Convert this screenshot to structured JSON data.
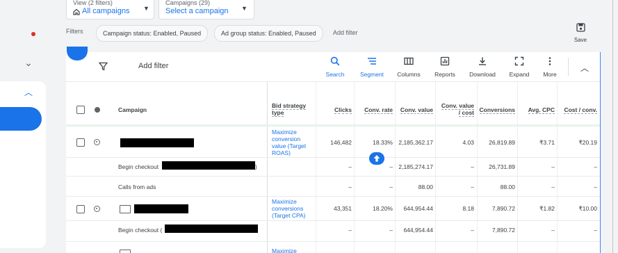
{
  "top": {
    "view": {
      "small": "View (2 filters)",
      "label": "All campaigns"
    },
    "campaigns": {
      "small": "Campaigns (29)",
      "label": "Select a campaign"
    }
  },
  "filters": {
    "label": "Filters",
    "chips": [
      "Campaign status: Enabled, Paused",
      "Ad group status: Enabled, Paused"
    ],
    "add": "Add filter",
    "save": "Save"
  },
  "toolbar": {
    "add_filter": "Add filter",
    "buttons": [
      "Search",
      "Segment",
      "Columns",
      "Reports",
      "Download",
      "Expand",
      "More"
    ]
  },
  "columns": {
    "campaign": "Campaign",
    "bid_strategy_type": [
      "Bid strategy",
      "type"
    ],
    "clicks": "Clicks",
    "conv_rate": "Conv. rate",
    "conv_value": "Conv. value",
    "conv_value_cost": [
      "Conv. value",
      "/ cost"
    ],
    "conversions": "Conversions",
    "avg_cpc": "Avg. CPC",
    "cost_conv": "Cost / conv."
  },
  "rows": [
    {
      "bid": [
        "Maximize",
        "conversion",
        "value (Target",
        "ROAS)"
      ],
      "clicks": "146,482",
      "conv_rate": "18.33%",
      "conv_value": "2,185,362.17",
      "conv_value_cost": "4.03",
      "conversions": "26,819.89",
      "avg_cpc": "₹3.71",
      "cost_conv": "₹20.19"
    },
    {
      "label": "Begin checkout",
      "label_suffix": ")",
      "clicks": "–",
      "conv_rate": "–",
      "conv_value": "2,185,274.17",
      "conv_value_cost": "–",
      "conversions": "26,731.89",
      "avg_cpc": "–",
      "cost_conv": "–"
    },
    {
      "label": "Calls from ads",
      "clicks": "–",
      "conv_rate": "–",
      "conv_value": "88.00",
      "conv_value_cost": "–",
      "conversions": "88.00",
      "avg_cpc": "–",
      "cost_conv": "–"
    },
    {
      "bid": [
        "Maximize",
        "conversions",
        "(Target CPA)"
      ],
      "clicks": "43,351",
      "conv_rate": "18.20%",
      "conv_value": "644,954.44",
      "conv_value_cost": "8.18",
      "conversions": "7,890.72",
      "avg_cpc": "₹1.82",
      "cost_conv": "₹10.00"
    },
    {
      "label": "Begin checkout (",
      "clicks": "–",
      "conv_rate": "–",
      "conv_value": "644,954.44",
      "conv_value_cost": "–",
      "conversions": "7,890.72",
      "avg_cpc": "–",
      "cost_conv": "–"
    },
    {
      "bid": [
        "Maximize"
      ]
    }
  ],
  "colors": {
    "accent": "#1a73e8",
    "text": "#3c4043",
    "muted": "#5f6368"
  }
}
